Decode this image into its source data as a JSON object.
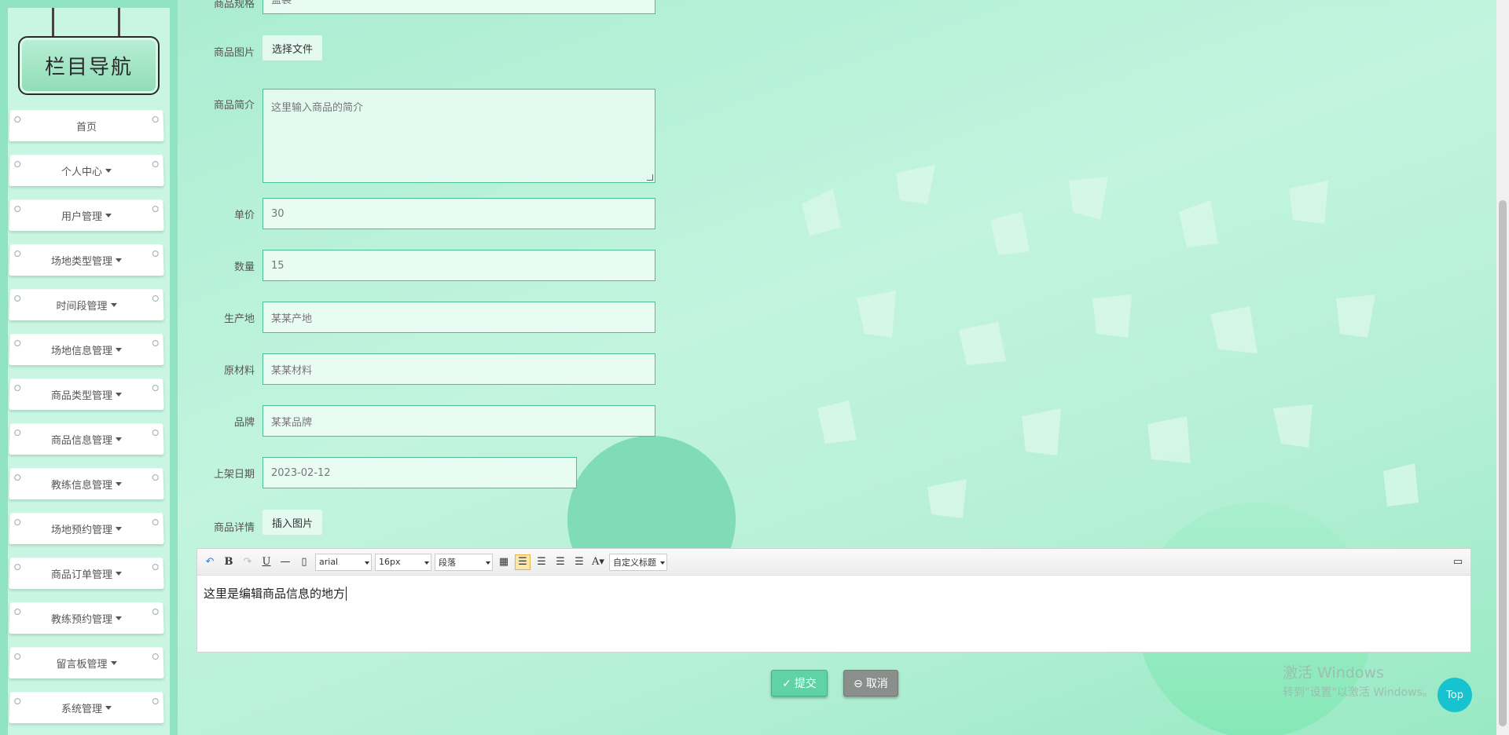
{
  "sidebar": {
    "title": "栏目导航",
    "items": [
      {
        "label": "首页",
        "dropdown": false
      },
      {
        "label": "个人中心",
        "dropdown": true
      },
      {
        "label": "用户管理",
        "dropdown": true
      },
      {
        "label": "场地类型管理",
        "dropdown": true
      },
      {
        "label": "时间段管理",
        "dropdown": true
      },
      {
        "label": "场地信息管理",
        "dropdown": true
      },
      {
        "label": "商品类型管理",
        "dropdown": true
      },
      {
        "label": "商品信息管理",
        "dropdown": true
      },
      {
        "label": "教练信息管理",
        "dropdown": true
      },
      {
        "label": "场地预约管理",
        "dropdown": true
      },
      {
        "label": "商品订单管理",
        "dropdown": true
      },
      {
        "label": "教练预约管理",
        "dropdown": true
      },
      {
        "label": "留言板管理",
        "dropdown": true
      },
      {
        "label": "系统管理",
        "dropdown": true
      }
    ]
  },
  "form": {
    "spec": {
      "label": "商品规格",
      "value": "盒装"
    },
    "image": {
      "label": "商品图片",
      "button": "选择文件"
    },
    "intro": {
      "label": "商品简介",
      "placeholder": "这里输入商品的简介"
    },
    "price": {
      "label": "单价",
      "value": "30"
    },
    "quantity": {
      "label": "数量",
      "value": "15"
    },
    "origin": {
      "label": "生产地",
      "value": "某某产地"
    },
    "material": {
      "label": "原材料",
      "value": "某某材料"
    },
    "brand": {
      "label": "品牌",
      "value": "某某品牌"
    },
    "date": {
      "label": "上架日期",
      "value": "2023-02-12"
    },
    "detail": {
      "label": "商品详情",
      "button": "插入图片"
    }
  },
  "editor": {
    "font_family": "arial",
    "font_size": "16px",
    "paragraph": "段落",
    "custom_heading": "自定义标题",
    "content": "这里是编辑商品信息的地方"
  },
  "actions": {
    "submit": "提交",
    "cancel": "取消",
    "top": "Top"
  },
  "watermark": {
    "line1": "激活 Windows",
    "line2": "转到\"设置\"以激活 Windows。"
  },
  "colors": {
    "accent": "#5fd3a5",
    "input_border": "#4fbf96",
    "top_button": "#17c3cf"
  }
}
